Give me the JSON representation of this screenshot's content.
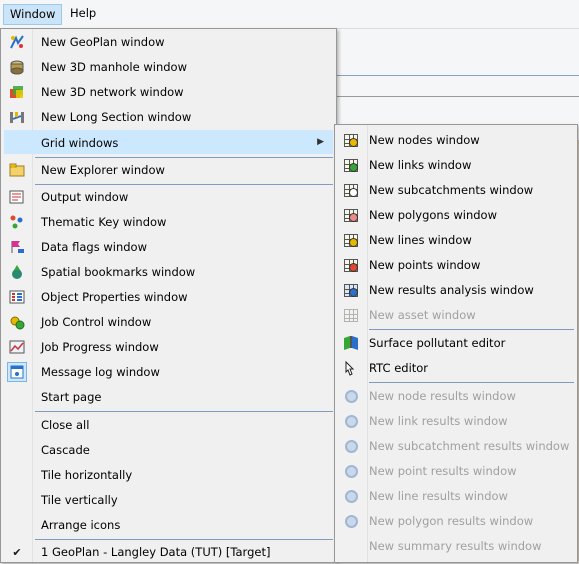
{
  "menubar": {
    "window_label": "Window",
    "help_label": "Help"
  },
  "main_menu": {
    "items": [
      {
        "label": "New GeoPlan window",
        "icon": "geoplan-icon"
      },
      {
        "label": "New 3D manhole window",
        "icon": "manhole-3d-icon"
      },
      {
        "label": "New 3D network window",
        "icon": "network-3d-icon"
      },
      {
        "label": "New Long Section window",
        "icon": "long-section-icon"
      },
      {
        "label": "Grid windows",
        "icon": "",
        "has_submenu": true
      },
      {
        "label": "New Explorer window",
        "icon": "explorer-icon"
      },
      {
        "label": "Output window",
        "icon": "output-icon"
      },
      {
        "label": "Thematic Key window",
        "icon": "thematic-key-icon"
      },
      {
        "label": "Data flags window",
        "icon": "data-flags-icon"
      },
      {
        "label": "Spatial bookmarks window",
        "icon": "spatial-bookmarks-icon"
      },
      {
        "label": "Object Properties window",
        "icon": "object-properties-icon"
      },
      {
        "label": "Job Control window",
        "icon": "job-control-icon"
      },
      {
        "label": "Job Progress window",
        "icon": "job-progress-icon"
      },
      {
        "label": "Message log window",
        "icon": "message-log-icon"
      },
      {
        "label": "Start page",
        "icon": ""
      },
      {
        "label": "Close all",
        "icon": ""
      },
      {
        "label": "Cascade",
        "icon": ""
      },
      {
        "label": "Tile horizontally",
        "icon": ""
      },
      {
        "label": "Tile vertically",
        "icon": ""
      },
      {
        "label": "Arrange icons",
        "icon": ""
      },
      {
        "label": "1 GeoPlan - Langley Data (TUT) [Target]",
        "icon": "check-icon"
      }
    ]
  },
  "grid_submenu": {
    "items": [
      {
        "label": "New nodes window",
        "enabled": true
      },
      {
        "label": "New links window",
        "enabled": true
      },
      {
        "label": "New subcatchments window",
        "enabled": true
      },
      {
        "label": "New polygons window",
        "enabled": true
      },
      {
        "label": "New lines window",
        "enabled": true
      },
      {
        "label": "New points window",
        "enabled": true
      },
      {
        "label": "New results analysis window",
        "enabled": true
      },
      {
        "label": "New asset window",
        "enabled": false
      },
      {
        "label": "Surface pollutant editor",
        "enabled": true
      },
      {
        "label": "RTC editor",
        "enabled": true
      },
      {
        "label": "New node results window",
        "enabled": false
      },
      {
        "label": "New link results window",
        "enabled": false
      },
      {
        "label": "New subcatchment results window",
        "enabled": false
      },
      {
        "label": "New point results window",
        "enabled": false
      },
      {
        "label": "New line results window",
        "enabled": false
      },
      {
        "label": "New polygon results window",
        "enabled": false
      },
      {
        "label": "New summary results window",
        "enabled": false
      }
    ]
  },
  "colors": {
    "highlight": "#cce8ff",
    "disabled_text": "#a0a0a0",
    "menu_bg": "#f0f0f0"
  }
}
